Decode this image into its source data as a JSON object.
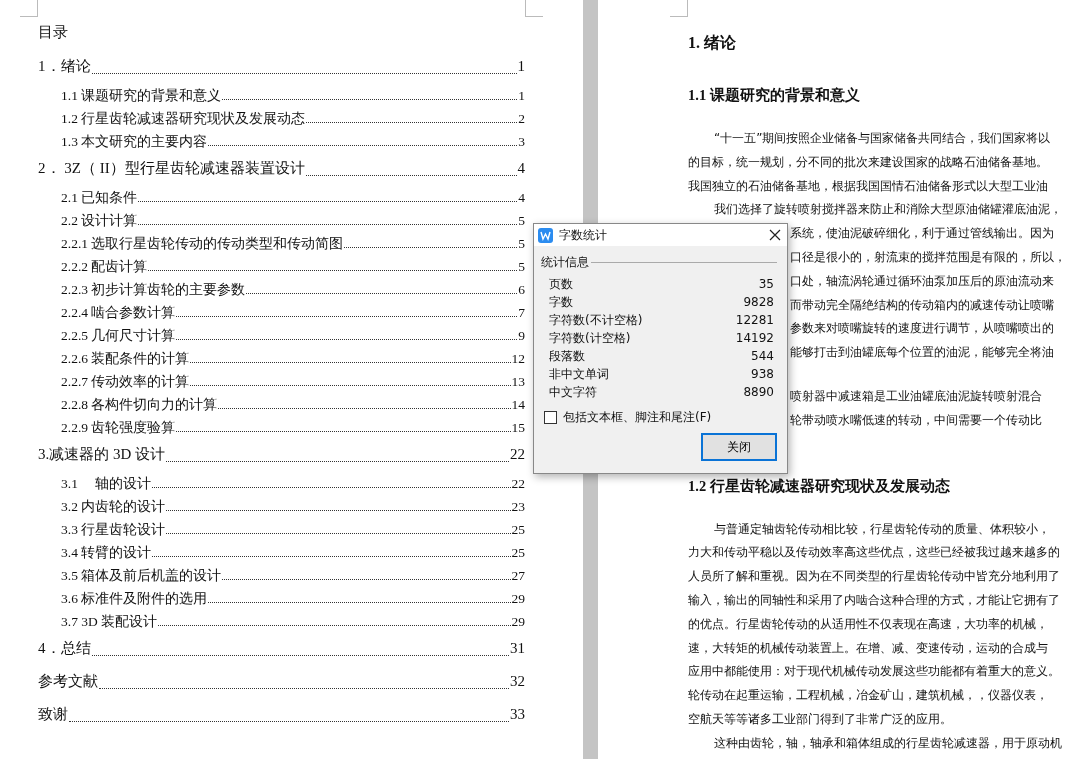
{
  "toc": {
    "title": "目录",
    "entries": [
      {
        "title": "1．绪论",
        "page": "1",
        "children": [
          {
            "title": "1.1 课题研究的背景和意义",
            "page": "1"
          },
          {
            "title": "1.2 行星齿轮减速器研究现状及发展动态",
            "page": "2"
          },
          {
            "title": "1.3 本文研究的主要内容",
            "page": "3"
          }
        ]
      },
      {
        "title": "2．  3Z（  II）型行星齿轮减速器装置设计",
        "page": "4",
        "children": [
          {
            "title": "2.1  已知条件",
            "page": "4"
          },
          {
            "title": "2.2  设计计算",
            "page": "5"
          },
          {
            "title": "2.2.1 选取行星齿轮传动的传动类型和传动简图",
            "page": "5"
          },
          {
            "title": "2.2.2 配齿计算",
            "page": "5"
          },
          {
            "title": "2.2.3 初步计算齿轮的主要参数",
            "page": "6"
          },
          {
            "title": "2.2.4 啮合参数计算",
            "page": "7"
          },
          {
            "title": "2.2.5 几何尺寸计算",
            "page": "9"
          },
          {
            "title": "2.2.6 装配条件的计算",
            "page": "12"
          },
          {
            "title": "2.2.7 传动效率的计算",
            "page": "13"
          },
          {
            "title": "2.2.8 各构件切向力的计算",
            "page": "14"
          },
          {
            "title": "2.2.9 齿轮强度验算",
            "page": "15"
          }
        ]
      },
      {
        "title": "3.减速器的 3D 设计",
        "page": "22",
        "children": [
          {
            "title": "3.1　 轴的设计",
            "page": "22"
          },
          {
            "title": "3.2 内齿轮的设计",
            "page": "23"
          },
          {
            "title": "3.3 行星齿轮设计",
            "page": "25"
          },
          {
            "title": "3.4 转臂的设计",
            "page": "25"
          },
          {
            "title": "3.5 箱体及前后机盖的设计",
            "page": "27"
          },
          {
            "title": "3.6 标准件及附件的选用",
            "page": "29"
          },
          {
            "title": "3.7 3D 装配设计",
            "page": "29"
          }
        ]
      },
      {
        "title": "4．总结",
        "page": "31"
      },
      {
        "title": "参考文献",
        "page": "32"
      },
      {
        "title": "致谢",
        "page": "33"
      }
    ]
  },
  "document": {
    "blocks": [
      {
        "kind": "h1",
        "lines": [
          "1.  绪论"
        ]
      },
      {
        "kind": "h2",
        "lines": [
          "1.1 课题研究的背景和意义"
        ]
      },
      {
        "kind": "paragraph",
        "lines": [
          "“十一五”期间按照企业储备与国家储备共同结合，我们国家将以",
          "的目标，统一规划，分不同的批次来建设国家的战略石油储备基地。",
          "我国独立的石油储备基地，根据我国国情石油储备形式以大型工业油"
        ]
      },
      {
        "kind": "paragraph",
        "lines": [
          "我们选择了旋转喷射搅拌器来防止和消除大型原油储罐灌底油泥，"
        ]
      },
      {
        "kind": "covered",
        "lines": [
          "系统，使油泥破碎细化，利于通过管线输出。因为",
          "口径是很小的，射流束的搅拌范围是有限的，所以，",
          "口处，轴流涡轮通过循环油泵加压后的原油流动来",
          "而带动完全隔绝结构的传动箱内的减速传动让喷嘴",
          "参数来对喷嘴旋转的速度进行调节，从喷嘴喷出的",
          "能够打击到油罐底每个位置的油泥，能够完全将油"
        ]
      },
      {
        "kind": "covered",
        "lines": [
          "喷射器中减速箱是工业油罐底油泥旋转喷射混合",
          "轮带动喷水嘴低速的转动，中间需要一个传动比"
        ]
      },
      {
        "kind": "h2",
        "lines": [
          "1.2 行星齿轮减速器研究现状及发展动态"
        ]
      },
      {
        "kind": "paragraph",
        "lines": [
          "与普通定轴齿轮传动相比较，行星齿轮传动的质量、体积较小，",
          "力大和传动平稳以及传动效率高这些优点，这些已经被我过越来越多的",
          "人员所了解和重视。因为在不同类型的行星齿轮传动中皆充分地利用了",
          "输入，输出的同轴性和采用了内啮合这种合理的方式，才能让它拥有了",
          "的优点。行星齿轮传动的从适用性不仅表现在高速，大功率的机械，",
          "速，大转矩的机械传动装置上。在增、减、变速传动，运动的合成与",
          "应用中都能使用：对于现代机械传动发展这些功能都有着重大的意义。",
          "轮传动在起重运输，工程机械，冶金矿山，建筑机械，，仪器仪表，",
          "空航天等等诸多工业部门得到了非常广泛的应用。"
        ]
      },
      {
        "kind": "paragraph",
        "lines": [
          "这种由齿轮，轴，轴承和箱体组成的行星齿轮减速器，用于原动机"
        ]
      }
    ]
  },
  "dialog": {
    "title": "字数统计",
    "group": "统计信息",
    "stats": [
      {
        "label": "页数",
        "value": "35"
      },
      {
        "label": "字数",
        "value": "9828"
      },
      {
        "label": "字符数(不计空格)",
        "value": "12281"
      },
      {
        "label": "字符数(计空格)",
        "value": "14192"
      },
      {
        "label": "段落数",
        "value": "544"
      },
      {
        "label": "非中文单词",
        "value": "938"
      },
      {
        "label": "中文字符",
        "value": "8890"
      }
    ],
    "option": {
      "label": "包括文本框、脚注和尾注(F)",
      "checked": false
    },
    "button": "关闭"
  }
}
